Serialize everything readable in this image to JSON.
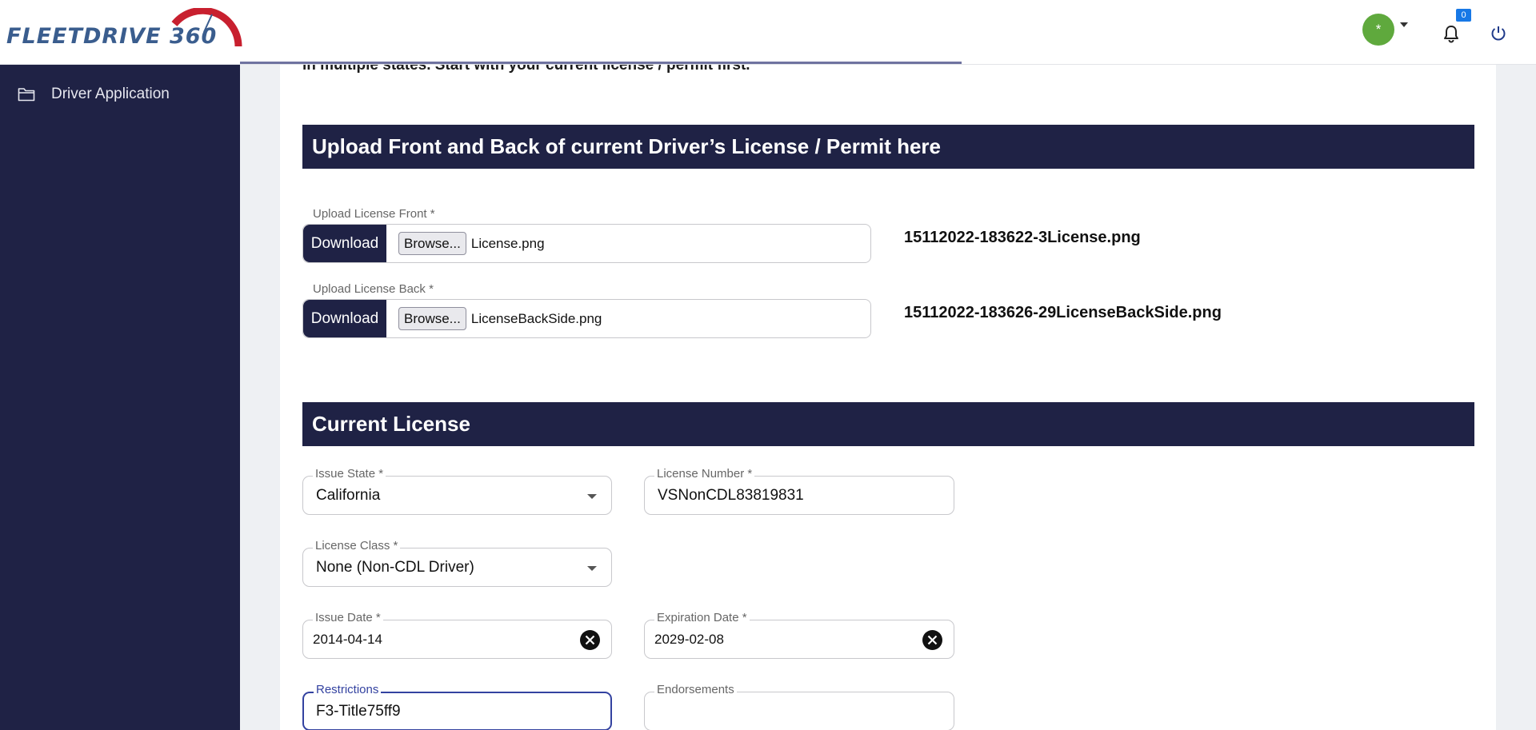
{
  "header": {
    "logo_text": "FLEETDRIVE 360",
    "avatar_initial": "*",
    "notification_count": "0"
  },
  "sidebar": {
    "items": [
      {
        "label": "Driver Application",
        "icon": "folder-icon"
      }
    ]
  },
  "main": {
    "intro_text": "in multiple states. Start with your current license / permit first.",
    "upload_section": {
      "title": "Upload Front and Back of current Driver’s License / Permit here",
      "front": {
        "label": "Upload License Front *",
        "download_label": "Download",
        "browse_label": "Browse...",
        "file_name": "License.png",
        "uploaded_name": "15112022-183622-3License.png"
      },
      "back": {
        "label": "Upload License Back *",
        "download_label": "Download",
        "browse_label": "Browse...",
        "file_name": "LicenseBackSide.png",
        "uploaded_name": "15112022-183626-29LicenseBackSide.png"
      }
    },
    "current_license": {
      "title": "Current License",
      "issue_state": {
        "label": "Issue State *",
        "value": "California"
      },
      "license_number": {
        "label": "License Number *",
        "value": "VSNonCDL83819831"
      },
      "license_class": {
        "label": "License Class *",
        "value": "None (Non-CDL Driver)"
      },
      "issue_date": {
        "label": "Issue Date *",
        "value": "2014-04-14"
      },
      "expiration_date": {
        "label": "Expiration Date *",
        "value": "2029-02-08"
      },
      "restrictions": {
        "label": "Restrictions",
        "value": "F3-Title75ff9"
      },
      "endorsements": {
        "label": "Endorsements",
        "value": ""
      }
    }
  },
  "colors": {
    "navy": "#1f2245",
    "avatar_green": "#5fa93d",
    "badge_blue": "#1778e6",
    "logo_red": "#c8202f",
    "logo_blue": "#3a5d8e"
  }
}
